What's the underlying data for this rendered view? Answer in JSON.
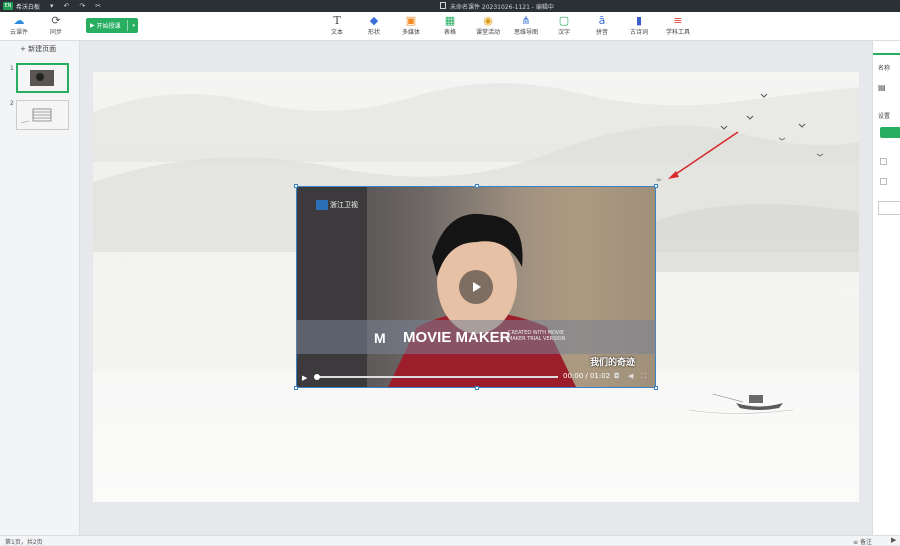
{
  "titlebar": {
    "app_name": "希沃白板",
    "document_title": "未命名课件 20231026-1121 - 编辑中"
  },
  "toolbar": {
    "cloud_label": "云课件",
    "sync_label": "同步",
    "start_label": "开始授课",
    "tools": [
      {
        "label": "文本",
        "icon": "text-icon"
      },
      {
        "label": "形状",
        "icon": "shape-icon"
      },
      {
        "label": "多媒体",
        "icon": "media-icon"
      },
      {
        "label": "表格",
        "icon": "table-icon"
      },
      {
        "label": "课堂活动",
        "icon": "activity-icon"
      },
      {
        "label": "思维导图",
        "icon": "mindmap-icon"
      },
      {
        "label": "汉字",
        "icon": "hanzi-icon"
      },
      {
        "label": "拼音",
        "icon": "pinyin-icon"
      },
      {
        "label": "古诗词",
        "icon": "poetry-icon"
      },
      {
        "label": "学科工具",
        "icon": "subject-tools-icon"
      }
    ]
  },
  "slides": {
    "new_page_label": "新建页面",
    "items": [
      {
        "number": "1",
        "active": true
      },
      {
        "number": "2",
        "active": false
      }
    ]
  },
  "video": {
    "station": "浙江卫视",
    "watermark": "MOVIE MAKER",
    "watermark_note": "CREATED WITH MOVIE MAKER TRIAL VERSION",
    "subtitle": "我们的奇迹",
    "time": "00:00 / 01:02",
    "progress": 0.0
  },
  "rightpanel": {
    "name_label": "名称",
    "settings_label": "设置"
  },
  "status": {
    "page_info": "第1页，共2页",
    "notes_label": "备注"
  }
}
